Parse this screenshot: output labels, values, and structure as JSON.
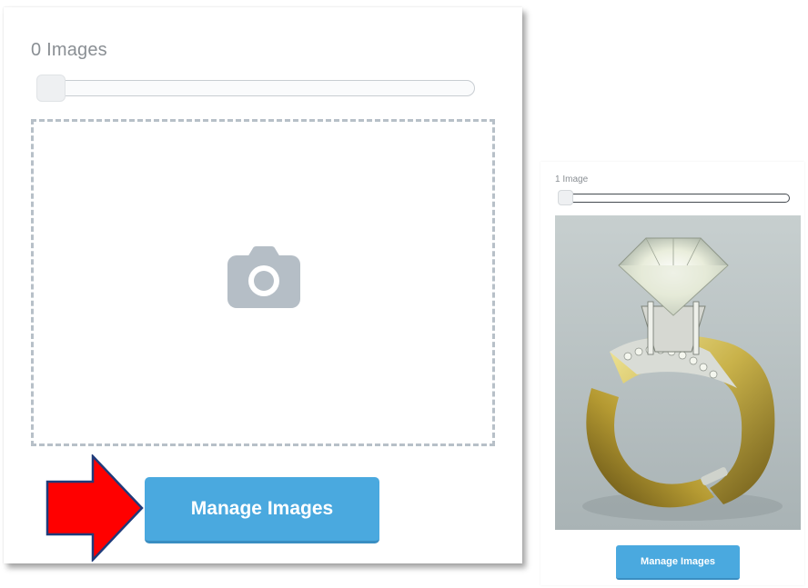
{
  "left_panel": {
    "image_count": "0 Images",
    "slider_value": 0,
    "camera_icon": "camera-icon",
    "manage_button": "Manage Images"
  },
  "annotation": {
    "arrow_icon": "red-arrow-right-icon",
    "arrow_color": "#ff0000",
    "arrow_outline": "#1f3b7a"
  },
  "right_panel": {
    "image_count": "1 Image",
    "slider_value": 0,
    "image_subject": "gold diamond ring photo",
    "manage_button": "Manage Images"
  },
  "colors": {
    "button": "#4aa9df",
    "button_shadow": "#3a8ec2",
    "dashed_border": "#b7c0c8",
    "camera": "#b5bec6",
    "count_text": "#8a8f94"
  }
}
